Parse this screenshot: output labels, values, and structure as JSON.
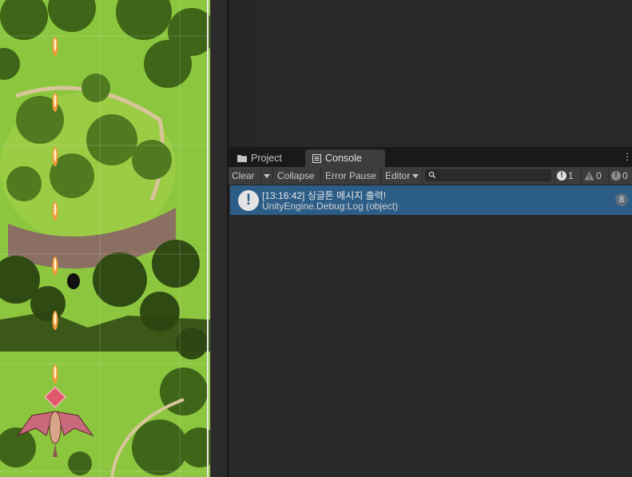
{
  "colors": {
    "grass": "#8cc63f",
    "forest_dark": "#2f4a12",
    "forest_mid": "#4f7a1f",
    "path": "#d8c69a",
    "cliff": "#8a6f62",
    "selection": "#2c5d87"
  },
  "tabs": [
    {
      "label": "Project",
      "icon": "folder-icon"
    },
    {
      "label": "Console",
      "icon": "console-list-icon"
    }
  ],
  "toolbar": {
    "clear": "Clear",
    "collapse": "Collapse",
    "error_pause": "Error Pause",
    "editor": "Editor",
    "search_value": ""
  },
  "counters": {
    "info": "1",
    "warning": "0",
    "error": "0"
  },
  "log": {
    "entries": [
      {
        "line1": "[13:16:42] 싱글톤 메시지 출력!",
        "line2": "UnityEngine.Debug:Log (object)",
        "count": "8",
        "icon": "info-icon"
      }
    ]
  }
}
